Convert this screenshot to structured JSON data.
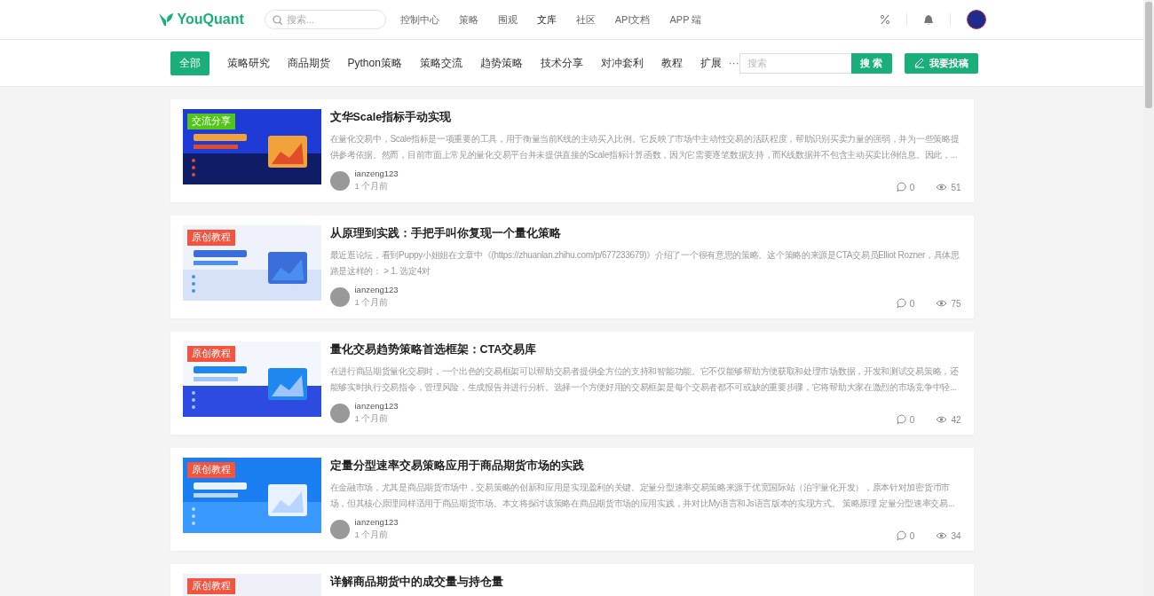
{
  "header": {
    "logo": "YouQuant",
    "search": {
      "placeholder": "搜索..."
    },
    "nav": [
      {
        "label": "控制中心",
        "selected": false
      },
      {
        "label": "策略",
        "selected": false
      },
      {
        "label": "围观",
        "selected": false
      },
      {
        "label": "文库",
        "selected": true
      },
      {
        "label": "社区",
        "selected": false
      },
      {
        "label": "API文档",
        "selected": false
      },
      {
        "label": "APP 端",
        "selected": false
      }
    ]
  },
  "categories": {
    "tabs": [
      {
        "label": "全部",
        "selected": true
      },
      {
        "label": "策略研究",
        "selected": false
      },
      {
        "label": "商品期货",
        "selected": false
      },
      {
        "label": "Python策略",
        "selected": false
      },
      {
        "label": "策略交流",
        "selected": false
      },
      {
        "label": "趋势策略",
        "selected": false
      },
      {
        "label": "技术分享",
        "selected": false
      },
      {
        "label": "对冲套利",
        "selected": false
      },
      {
        "label": "教程",
        "selected": false
      },
      {
        "label": "扩展",
        "selected": false
      }
    ],
    "more": "···",
    "search": {
      "placeholder": "搜索",
      "button": "搜索"
    },
    "submit": "我要投稿"
  },
  "articles": [
    {
      "tag": {
        "label": "交流分享",
        "color": "#52c41a"
      },
      "title": "文华Scale指标手动实现",
      "summary": "在量化交易中，Scale指标是一项重要的工具，用于衡量当前K线的主动买入比例。它反映了市场中主动性交易的活跃程度，帮助识别买卖力量的强弱，并为一些策略提供参考依据。然而，目前市面上常见的量化交易平台并未提供直接的Scale指标计算函数，因为它需要逐笔数据支持，而K线数据并不包含主动买卖比例信息。因此，...",
      "author": "ianzeng123",
      "time": "1 个月前",
      "comments": "0",
      "views": "51"
    },
    {
      "tag": {
        "label": "原创教程",
        "color": "#f5533d"
      },
      "title": "从原理到实践：手把手叫你复现一个量化策略",
      "summary": "最近逛论坛，看到Puppy小姐姐在文章中《(https://zhuanlan.zhihu.com/p/677233679)》介绍了一个很有意思的策略。这个策略的来源是CTA交易员Elliot Rozner，具体思路是这样的： > 1. 选定4对",
      "author": "ianzeng123",
      "time": "1 个月前",
      "comments": "0",
      "views": "75"
    },
    {
      "tag": {
        "label": "原创教程",
        "color": "#f5533d"
      },
      "title": "量化交易趋势策略首选框架：CTA交易库",
      "summary": "在进行商品期货量化交易时，一个出色的交易框架可以帮助交易者提供全方位的支持和智能功能。它不仅能够帮助方便获取和处理市场数据，开发和测试交易策略，还能够实时执行交易指令，管理风险，生成报告并进行分析。选择一个方便好用的交易框架是每个交易者都不可或缺的重要步骤，它将帮助大家在激烈的市场竞争中轻...",
      "author": "ianzeng123",
      "time": "1 个月前",
      "comments": "0",
      "views": "42"
    },
    {
      "tag": {
        "label": "原创教程",
        "color": "#f5533d"
      },
      "title": "定量分型速率交易策略应用于商品期货市场的实践",
      "summary": "在金融市场，尤其是商品期货市场中，交易策略的创新和应用是实现盈利的关键。定量分型速率交易策略来源于优宽国际站（泊宇量化开发），原本针对加密货币市场，但其核心原理同样适用于商品期货市场。本文将探讨该策略在商品期货市场的应用实践，并对比My语言和Js语言版本的实现方式。 策略原理 定量分型速率交易...",
      "author": "ianzeng123",
      "time": "1 个月前",
      "comments": "0",
      "views": "34"
    },
    {
      "tag": {
        "label": "原创教程",
        "color": "#f5533d"
      },
      "title": "详解商品期货中的成交量与持仓量"
    }
  ]
}
